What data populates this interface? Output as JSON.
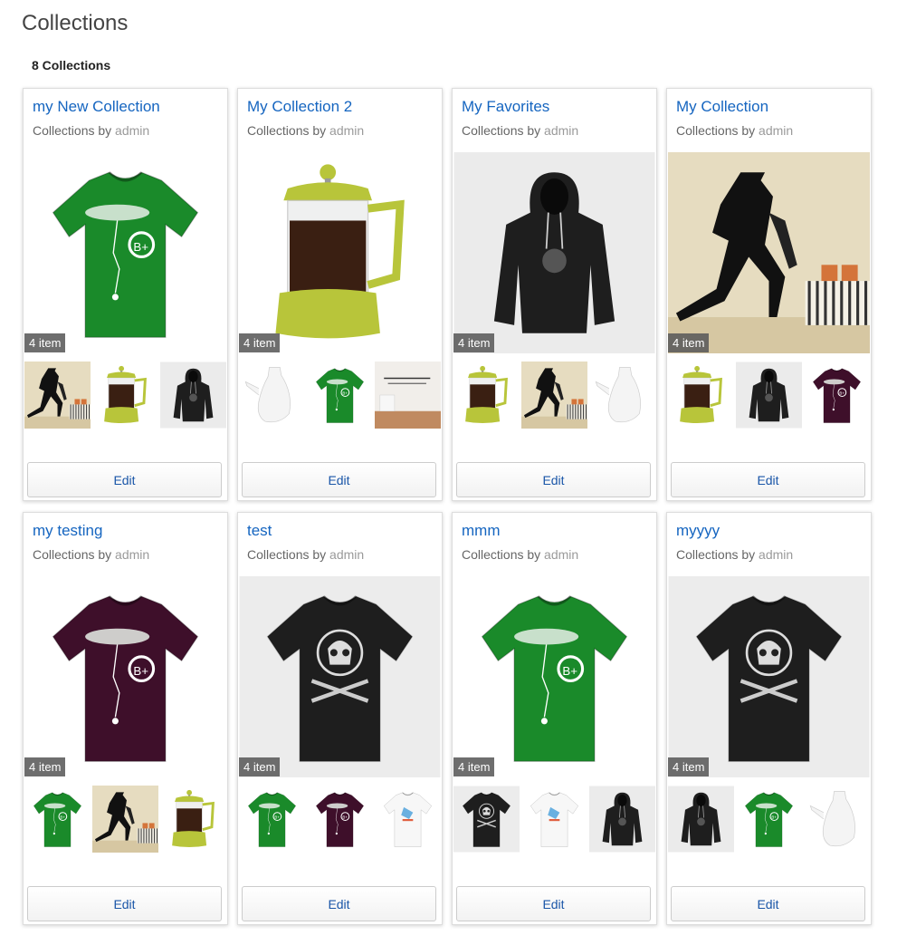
{
  "page": {
    "title": "Collections",
    "count_label": "8 Collections"
  },
  "byline_prefix": "Collections by",
  "cards": [
    {
      "title": "my New Collection",
      "author": "admin",
      "badge": "4 item",
      "edit_label": "Edit",
      "hero": "tshirt-green",
      "thumbs": [
        "wall-dancer",
        "french-press",
        "hoodie-black"
      ]
    },
    {
      "title": "My Collection 2",
      "author": "admin",
      "badge": "4 item",
      "edit_label": "Edit",
      "hero": "french-press",
      "thumbs": [
        "kettle-white",
        "tshirt-green",
        "wall-quote"
      ]
    },
    {
      "title": "My Favorites",
      "author": "admin",
      "badge": "4 item",
      "edit_label": "Edit",
      "hero": "hoodie-black",
      "thumbs": [
        "french-press",
        "wall-dancer",
        "kettle-white"
      ]
    },
    {
      "title": "My Collection",
      "author": "admin",
      "badge": "4 item",
      "edit_label": "Edit",
      "hero": "wall-dancer",
      "thumbs": [
        "french-press",
        "hoodie-black",
        "tshirt-purple"
      ]
    },
    {
      "title": "my testing",
      "author": "admin",
      "badge": "4 item",
      "edit_label": "Edit",
      "hero": "tshirt-purple",
      "thumbs": [
        "tshirt-green",
        "wall-dancer",
        "french-press"
      ]
    },
    {
      "title": "test",
      "author": "admin",
      "badge": "4 item",
      "edit_label": "Edit",
      "hero": "tshirt-black-skull",
      "thumbs": [
        "tshirt-green",
        "tshirt-purple",
        "tshirt-white-print"
      ]
    },
    {
      "title": "mmm",
      "author": "admin",
      "badge": "4 item",
      "edit_label": "Edit",
      "hero": "tshirt-green",
      "thumbs": [
        "tshirt-black-skull",
        "tshirt-white-print",
        "hoodie-black"
      ]
    },
    {
      "title": "myyyy",
      "author": "admin",
      "badge": "4 item",
      "edit_label": "Edit",
      "hero": "tshirt-black-skull",
      "thumbs": [
        "hoodie-black",
        "tshirt-green",
        "kettle-white"
      ]
    }
  ],
  "colors": {
    "link": "#1565c0",
    "tshirt_green": "#1a8a2a",
    "tshirt_purple": "#3e0f2a",
    "tshirt_black": "#1e1e1e",
    "press_lime": "#b8c53a",
    "wall_beige": "#e6dcc0"
  }
}
